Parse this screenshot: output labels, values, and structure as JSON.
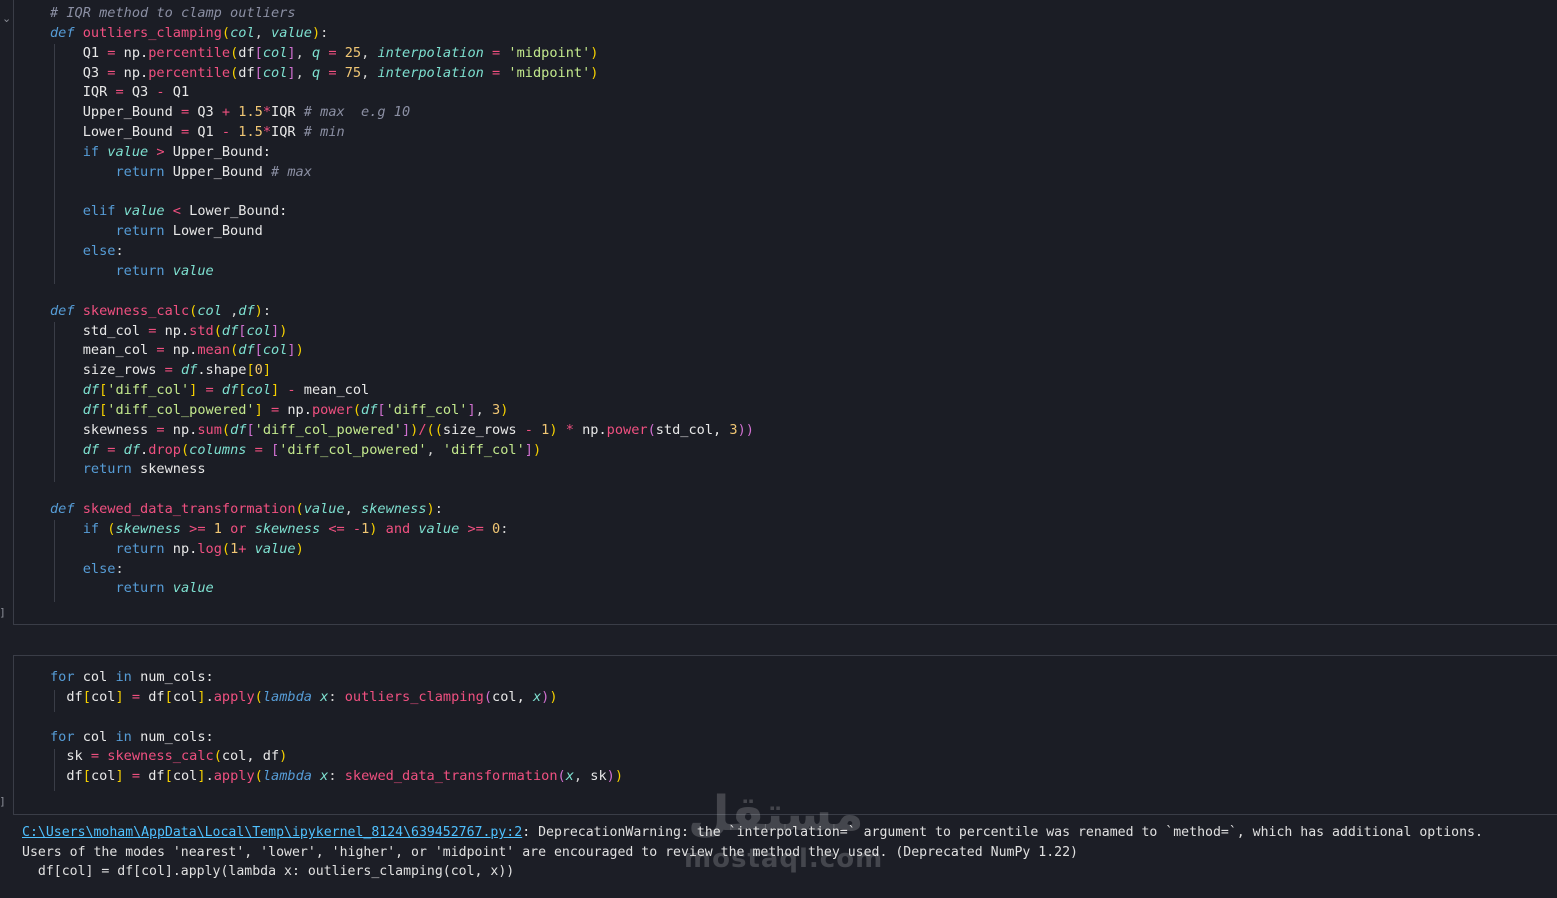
{
  "cells": [
    {
      "id": "cell-1",
      "lines": [
        [
          [
            "cm",
            "# IQR method to clamp outliers"
          ]
        ],
        [
          [
            "kwi",
            "def "
          ],
          [
            "fn",
            "outliers_clamping"
          ],
          [
            "br",
            "("
          ],
          [
            "pa",
            "col"
          ],
          [
            "pu",
            ", "
          ],
          [
            "pa",
            "value"
          ],
          [
            "br",
            ")"
          ],
          [
            "pu",
            ":"
          ]
        ],
        [
          [
            "va",
            "    Q1 "
          ],
          [
            "op",
            "="
          ],
          [
            "va",
            " np."
          ],
          [
            "fn",
            "percentile"
          ],
          [
            "br",
            "("
          ],
          [
            "va",
            "df"
          ],
          [
            "br2",
            "["
          ],
          [
            "pa",
            "col"
          ],
          [
            "br2",
            "]"
          ],
          [
            "pu",
            ", "
          ],
          [
            "pa",
            "q"
          ],
          [
            "op",
            " = "
          ],
          [
            "nu",
            "25"
          ],
          [
            "pu",
            ", "
          ],
          [
            "pa",
            "interpolation"
          ],
          [
            "op",
            " = "
          ],
          [
            "st",
            "'midpoint'"
          ],
          [
            "br",
            ")"
          ]
        ],
        [
          [
            "va",
            "    Q3 "
          ],
          [
            "op",
            "="
          ],
          [
            "va",
            " np."
          ],
          [
            "fn",
            "percentile"
          ],
          [
            "br",
            "("
          ],
          [
            "va",
            "df"
          ],
          [
            "br2",
            "["
          ],
          [
            "pa",
            "col"
          ],
          [
            "br2",
            "]"
          ],
          [
            "pu",
            ", "
          ],
          [
            "pa",
            "q"
          ],
          [
            "op",
            " = "
          ],
          [
            "nu",
            "75"
          ],
          [
            "pu",
            ", "
          ],
          [
            "pa",
            "interpolation"
          ],
          [
            "op",
            " = "
          ],
          [
            "st",
            "'midpoint'"
          ],
          [
            "br",
            ")"
          ]
        ],
        [
          [
            "va",
            "    IQR "
          ],
          [
            "op",
            "="
          ],
          [
            "va",
            " Q3 "
          ],
          [
            "op",
            "-"
          ],
          [
            "va",
            " Q1"
          ]
        ],
        [
          [
            "va",
            "    Upper_Bound "
          ],
          [
            "op",
            "="
          ],
          [
            "va",
            " Q3 "
          ],
          [
            "op",
            "+"
          ],
          [
            "nu",
            " 1.5"
          ],
          [
            "op",
            "*"
          ],
          [
            "va",
            "IQR "
          ],
          [
            "cm",
            "# max  e.g 10"
          ]
        ],
        [
          [
            "va",
            "    Lower_Bound "
          ],
          [
            "op",
            "="
          ],
          [
            "va",
            " Q1 "
          ],
          [
            "op",
            "-"
          ],
          [
            "nu",
            " 1.5"
          ],
          [
            "op",
            "*"
          ],
          [
            "va",
            "IQR "
          ],
          [
            "cm",
            "# min"
          ]
        ],
        [
          [
            "kw",
            "    if "
          ],
          [
            "pa",
            "value"
          ],
          [
            "op",
            " > "
          ],
          [
            "va",
            "Upper_Bound:"
          ]
        ],
        [
          [
            "kw",
            "        return "
          ],
          [
            "va",
            "Upper_Bound "
          ],
          [
            "cm",
            "# max"
          ]
        ],
        [
          [
            "va",
            ""
          ]
        ],
        [
          [
            "kw",
            "    elif "
          ],
          [
            "pa",
            "value"
          ],
          [
            "op",
            " < "
          ],
          [
            "va",
            "Lower_Bound:"
          ]
        ],
        [
          [
            "kw",
            "        return "
          ],
          [
            "va",
            "Lower_Bound"
          ]
        ],
        [
          [
            "kw",
            "    else"
          ],
          [
            "pu",
            ":"
          ]
        ],
        [
          [
            "kw",
            "        return "
          ],
          [
            "pa",
            "value"
          ]
        ],
        [
          [
            "va",
            ""
          ]
        ],
        [
          [
            "kwi",
            "def "
          ],
          [
            "fn",
            "skewness_calc"
          ],
          [
            "br",
            "("
          ],
          [
            "pa",
            "col"
          ],
          [
            "pu",
            " ,"
          ],
          [
            "pa",
            "df"
          ],
          [
            "br",
            ")"
          ],
          [
            "pu",
            ":"
          ]
        ],
        [
          [
            "va",
            "    std_col "
          ],
          [
            "op",
            "="
          ],
          [
            "va",
            " np."
          ],
          [
            "fn",
            "std"
          ],
          [
            "br",
            "("
          ],
          [
            "pa",
            "df"
          ],
          [
            "br2",
            "["
          ],
          [
            "pa",
            "col"
          ],
          [
            "br2",
            "]"
          ],
          [
            "br",
            ")"
          ]
        ],
        [
          [
            "va",
            "    mean_col "
          ],
          [
            "op",
            "="
          ],
          [
            "va",
            " np."
          ],
          [
            "fn",
            "mean"
          ],
          [
            "br",
            "("
          ],
          [
            "pa",
            "df"
          ],
          [
            "br2",
            "["
          ],
          [
            "pa",
            "col"
          ],
          [
            "br2",
            "]"
          ],
          [
            "br",
            ")"
          ]
        ],
        [
          [
            "va",
            "    size_rows "
          ],
          [
            "op",
            "="
          ],
          [
            "pa",
            " df"
          ],
          [
            "va",
            ".shape"
          ],
          [
            "br",
            "["
          ],
          [
            "nu",
            "0"
          ],
          [
            "br",
            "]"
          ]
        ],
        [
          [
            "pa",
            "    df"
          ],
          [
            "br",
            "["
          ],
          [
            "st",
            "'diff_col'"
          ],
          [
            "br",
            "]"
          ],
          [
            "op",
            " = "
          ],
          [
            "pa",
            "df"
          ],
          [
            "br",
            "["
          ],
          [
            "pa",
            "col"
          ],
          [
            "br",
            "]"
          ],
          [
            "op",
            " - "
          ],
          [
            "va",
            "mean_col"
          ]
        ],
        [
          [
            "pa",
            "    df"
          ],
          [
            "br",
            "["
          ],
          [
            "st",
            "'diff_col_powered'"
          ],
          [
            "br",
            "]"
          ],
          [
            "op",
            " = "
          ],
          [
            "va",
            "np."
          ],
          [
            "fn",
            "power"
          ],
          [
            "br",
            "("
          ],
          [
            "pa",
            "df"
          ],
          [
            "br2",
            "["
          ],
          [
            "st",
            "'diff_col'"
          ],
          [
            "br2",
            "]"
          ],
          [
            "pu",
            ", "
          ],
          [
            "nu",
            "3"
          ],
          [
            "br",
            ")"
          ]
        ],
        [
          [
            "va",
            "    skewness "
          ],
          [
            "op",
            "="
          ],
          [
            "va",
            " np."
          ],
          [
            "fn",
            "sum"
          ],
          [
            "br",
            "("
          ],
          [
            "pa",
            "df"
          ],
          [
            "br2",
            "["
          ],
          [
            "st",
            "'diff_col_powered'"
          ],
          [
            "br2",
            "]"
          ],
          [
            "br",
            ")"
          ],
          [
            "op",
            "/"
          ],
          [
            "br",
            "(("
          ],
          [
            "va",
            "size_rows "
          ],
          [
            "op",
            "-"
          ],
          [
            "nu",
            " 1"
          ],
          [
            "br",
            ")"
          ],
          [
            "op",
            " * "
          ],
          [
            "va",
            "np."
          ],
          [
            "fn",
            "power"
          ],
          [
            "br2",
            "("
          ],
          [
            "va",
            "std_col, "
          ],
          [
            "nu",
            "3"
          ],
          [
            "br2",
            "))"
          ]
        ],
        [
          [
            "pa",
            "    df"
          ],
          [
            "op",
            " = "
          ],
          [
            "pa",
            "df"
          ],
          [
            "va",
            "."
          ],
          [
            "fn",
            "drop"
          ],
          [
            "br",
            "("
          ],
          [
            "pa",
            "columns"
          ],
          [
            "op",
            " = "
          ],
          [
            "br2",
            "["
          ],
          [
            "st",
            "'diff_col_powered'"
          ],
          [
            "pu",
            ", "
          ],
          [
            "st",
            "'diff_col'"
          ],
          [
            "br2",
            "]"
          ],
          [
            "br",
            ")"
          ]
        ],
        [
          [
            "kw",
            "    return "
          ],
          [
            "va",
            "skewness"
          ]
        ],
        [
          [
            "va",
            ""
          ]
        ],
        [
          [
            "kwi",
            "def "
          ],
          [
            "fn",
            "skewed_data_transformation"
          ],
          [
            "br",
            "("
          ],
          [
            "pa",
            "value"
          ],
          [
            "pu",
            ", "
          ],
          [
            "pa",
            "skewness"
          ],
          [
            "br",
            ")"
          ],
          [
            "pu",
            ":"
          ]
        ],
        [
          [
            "kw",
            "    if "
          ],
          [
            "br",
            "("
          ],
          [
            "pa",
            "skewness"
          ],
          [
            "op",
            " >= "
          ],
          [
            "nu",
            "1"
          ],
          [
            "op",
            " or "
          ],
          [
            "pa",
            "skewness"
          ],
          [
            "op",
            " <= "
          ],
          [
            "op",
            "-"
          ],
          [
            "nu",
            "1"
          ],
          [
            "br",
            ")"
          ],
          [
            "op",
            " and "
          ],
          [
            "pa",
            "value"
          ],
          [
            "op",
            " >= "
          ],
          [
            "nu",
            "0"
          ],
          [
            "pu",
            ":"
          ]
        ],
        [
          [
            "kw",
            "        return "
          ],
          [
            "va",
            "np."
          ],
          [
            "fn",
            "log"
          ],
          [
            "br",
            "("
          ],
          [
            "nu",
            "1"
          ],
          [
            "op",
            "+ "
          ],
          [
            "pa",
            "value"
          ],
          [
            "br",
            ")"
          ]
        ],
        [
          [
            "kw",
            "    else"
          ],
          [
            "pu",
            ":"
          ]
        ],
        [
          [
            "kw",
            "        return "
          ],
          [
            "pa",
            "value"
          ]
        ]
      ]
    },
    {
      "id": "cell-2",
      "lines": [
        [
          [
            "kw",
            "for "
          ],
          [
            "va",
            "col "
          ],
          [
            "kw",
            "in "
          ],
          [
            "va",
            "num_cols:"
          ]
        ],
        [
          [
            "va",
            "  df"
          ],
          [
            "br",
            "["
          ],
          [
            "va",
            "col"
          ],
          [
            "br",
            "]"
          ],
          [
            "op",
            " = "
          ],
          [
            "va",
            "df"
          ],
          [
            "br",
            "["
          ],
          [
            "va",
            "col"
          ],
          [
            "br",
            "]"
          ],
          [
            "va",
            "."
          ],
          [
            "fn",
            "apply"
          ],
          [
            "br",
            "("
          ],
          [
            "kwi",
            "lambda "
          ],
          [
            "pa",
            "x"
          ],
          [
            "pu",
            ": "
          ],
          [
            "fn",
            "outliers_clamping"
          ],
          [
            "br2",
            "("
          ],
          [
            "va",
            "col, "
          ],
          [
            "pa",
            "x"
          ],
          [
            "br2",
            ")"
          ],
          [
            "br",
            ")"
          ]
        ],
        [
          [
            "va",
            ""
          ]
        ],
        [
          [
            "kw",
            "for "
          ],
          [
            "va",
            "col "
          ],
          [
            "kw",
            "in "
          ],
          [
            "va",
            "num_cols:"
          ]
        ],
        [
          [
            "va",
            "  sk "
          ],
          [
            "op",
            "="
          ],
          [
            "fn",
            " skewness_calc"
          ],
          [
            "br",
            "("
          ],
          [
            "va",
            "col, df"
          ],
          [
            "br",
            ")"
          ]
        ],
        [
          [
            "va",
            "  df"
          ],
          [
            "br",
            "["
          ],
          [
            "va",
            "col"
          ],
          [
            "br",
            "]"
          ],
          [
            "op",
            " = "
          ],
          [
            "va",
            "df"
          ],
          [
            "br",
            "["
          ],
          [
            "va",
            "col"
          ],
          [
            "br",
            "]"
          ],
          [
            "va",
            "."
          ],
          [
            "fn",
            "apply"
          ],
          [
            "br",
            "("
          ],
          [
            "kwi",
            "lambda "
          ],
          [
            "pa",
            "x"
          ],
          [
            "pu",
            ": "
          ],
          [
            "fn",
            "skewed_data_transformation"
          ],
          [
            "br2",
            "("
          ],
          [
            "pa",
            "x"
          ],
          [
            "pu",
            ", "
          ],
          [
            "va",
            "sk"
          ],
          [
            "br2",
            ")"
          ],
          [
            "br",
            ")"
          ]
        ]
      ]
    }
  ],
  "output": {
    "path_link": "C:\\Users\\moham\\AppData\\Local\\Temp\\ipykernel_8124\\639452767.py:2",
    "line1_rest": ": DeprecationWarning: the `interpolation=` argument to percentile was renamed to `method=`, which has additional options.",
    "line2": "Users of the modes 'nearest', 'lower', 'higher', or 'midpoint' are encouraged to review the method they used. (Deprecated NumPy 1.22)",
    "line3": "  df[col] = df[col].apply(lambda x: outliers_clamping(col, x))"
  },
  "gutter": {
    "collapse_marker": "⌄",
    "bracket_marker_1": "]",
    "bracket_marker_2": "]"
  },
  "watermark": {
    "arabic": "مستقل",
    "latin": "mostaql.com"
  }
}
